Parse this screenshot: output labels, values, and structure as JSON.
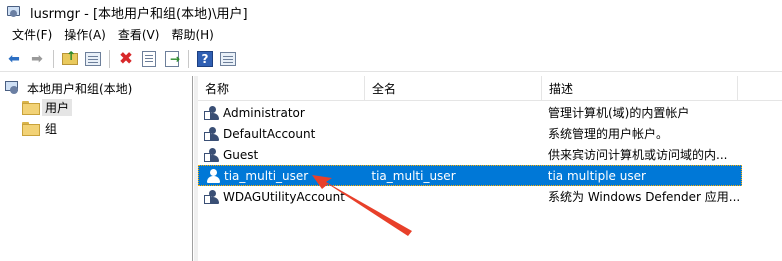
{
  "window": {
    "title": "lusrmgr - [本地用户和组(本地)\\用户]"
  },
  "menu": {
    "items": [
      "文件(F)",
      "操作(A)",
      "查看(V)",
      "帮助(H)"
    ]
  },
  "toolbar": {
    "icons": [
      "back-arrow-icon",
      "forward-arrow-icon",
      "up-folder-icon",
      "show-hide-tree-icon",
      "delete-icon",
      "properties-icon",
      "export-list-icon",
      "help-icon",
      "show-action-pane-icon"
    ]
  },
  "tree": {
    "root": "本地用户和组(本地)",
    "children": [
      "用户",
      "组"
    ]
  },
  "list": {
    "columns": [
      "名称",
      "全名",
      "描述"
    ],
    "rows": [
      {
        "name": "Administrator",
        "fullname": "",
        "description": "管理计算机(域)的内置帐户"
      },
      {
        "name": "DefaultAccount",
        "fullname": "",
        "description": "系统管理的用户帐户。"
      },
      {
        "name": "Guest",
        "fullname": "",
        "description": "供来宾访问计算机或访问域的内..."
      },
      {
        "name": "tia_multi_user",
        "fullname": "tia_multi_user",
        "description": "tia multiple user"
      },
      {
        "name": "WDAGUtilityAccount",
        "fullname": "",
        "description": "系统为 Windows Defender 应用..."
      }
    ],
    "selected_index": 3
  },
  "colors": {
    "selection": "#0078d7",
    "annotation_arrow": "#e8402a"
  }
}
